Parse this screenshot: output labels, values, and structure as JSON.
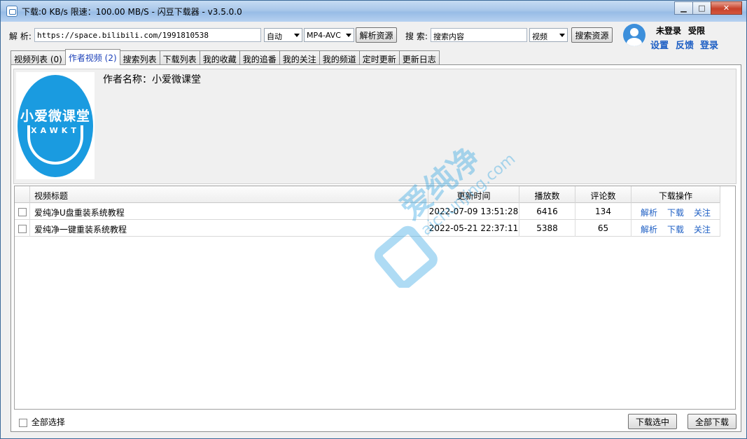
{
  "window": {
    "title": "下载:0 KB/s  限速：100.00 MB/S  - 闪豆下载器 - v3.5.0.0",
    "minimize": "▁",
    "maximize": "□",
    "close": "✕"
  },
  "toolbar": {
    "parse_label": "解 析:",
    "parse_url": "https://space.bilibili.com/1991810538",
    "quality_value": "自动",
    "format_value": "MP4-AVC",
    "parse_button": "解析资源",
    "search_label": "搜 索:",
    "search_value": "搜索内容",
    "search_type": "视频",
    "search_button": "搜索资源"
  },
  "user": {
    "login_status": "未登录",
    "restriction": "受限",
    "settings": "设置",
    "feedback": "反馈",
    "login": "登录"
  },
  "tabs": [
    {
      "label": "视频列表 (0)"
    },
    {
      "label": "作者视频 (2)"
    },
    {
      "label": "搜索列表"
    },
    {
      "label": "下载列表"
    },
    {
      "label": "我的收藏"
    },
    {
      "label": "我的追番"
    },
    {
      "label": "我的关注"
    },
    {
      "label": "我的频道"
    },
    {
      "label": "定时更新"
    },
    {
      "label": "更新日志"
    }
  ],
  "author": {
    "name_label": "作者名称：小爱微课堂",
    "logo_title": "小爱微课堂",
    "logo_sub": "XAWKT"
  },
  "table": {
    "headers": {
      "title": "视频标题",
      "updated": "更新时间",
      "plays": "播放数",
      "comments": "评论数",
      "actions": "下载操作"
    },
    "rows": [
      {
        "title": "爱纯净U盘重装系统教程",
        "updated": "2022-07-09 13:51:28",
        "plays": "6416",
        "comments": "134"
      },
      {
        "title": "爱纯净一键重装系统教程",
        "updated": "2022-05-21 22:37:11",
        "plays": "5388",
        "comments": "65"
      }
    ],
    "action_labels": {
      "parse": "解析",
      "download": "下载",
      "follow": "关注"
    }
  },
  "watermark": {
    "brand": "爱纯净",
    "domain": "aichunjing.com"
  },
  "footer": {
    "select_all": "全部选择",
    "download_selected": "下载选中",
    "download_all": "全部下载"
  },
  "colors": {
    "accent": "#1e5fc4",
    "logo": "#1a9be0"
  }
}
